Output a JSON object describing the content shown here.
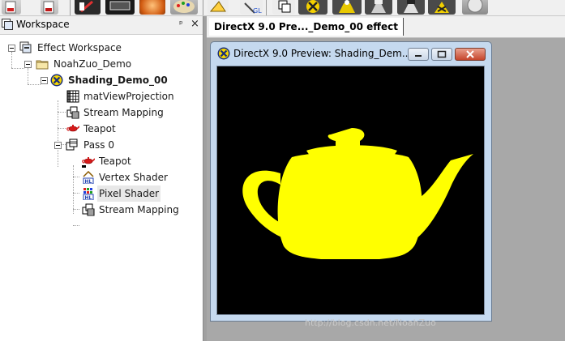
{
  "toolbar": {
    "icons": [
      "shader-file-icon",
      "effect-file-icon",
      "paint-edit-icon",
      "render-target-icon",
      "material-icon",
      "palette-icon",
      "shape-tool-icon",
      "gl-tool-icon",
      "copy-layers-icon",
      "directx-run-icon",
      "camera-run-icon",
      "camera-icon",
      "camera-film-icon",
      "directx-alt-icon",
      "sphere-icon"
    ]
  },
  "workspace": {
    "title": "Workspace",
    "pin_glyph": "ᵖ",
    "close_glyph": "×",
    "tree": [
      {
        "label": "Effect Workspace",
        "level": 0,
        "icon": "effect-workspace-icon",
        "expanded": true
      },
      {
        "label": "NoahZuo_Demo",
        "level": 1,
        "icon": "folder-icon",
        "expanded": true
      },
      {
        "label": "Shading_Demo_00",
        "level": 2,
        "icon": "directx-effect-icon",
        "expanded": true,
        "bold": true
      },
      {
        "label": "matViewProjection",
        "level": 3,
        "icon": "matrix-icon"
      },
      {
        "label": "Stream Mapping",
        "level": 3,
        "icon": "stream-mapping-icon"
      },
      {
        "label": "Teapot",
        "level": 3,
        "icon": "teapot-icon"
      },
      {
        "label": "Pass 0",
        "level": 3,
        "icon": "pass-icon",
        "expanded": true
      },
      {
        "label": "Teapot",
        "level": 4,
        "icon": "teapot-icon"
      },
      {
        "label": "Vertex Shader",
        "level": 4,
        "icon": "vertex-shader-icon"
      },
      {
        "label": "Pixel Shader",
        "level": 4,
        "icon": "pixel-shader-icon",
        "selected": true
      },
      {
        "label": "Stream Mapping",
        "level": 4,
        "icon": "stream-mapping-icon"
      }
    ]
  },
  "document": {
    "tab_label": "DirectX 9.0 Pre..._Demo_00 effect"
  },
  "preview": {
    "title": "DirectX 9.0 Preview: Shading_Dem...",
    "teapot_color": "#ffff00",
    "background_color": "#000000"
  },
  "watermark": "http://blog.csdn.net/NoahZuo"
}
